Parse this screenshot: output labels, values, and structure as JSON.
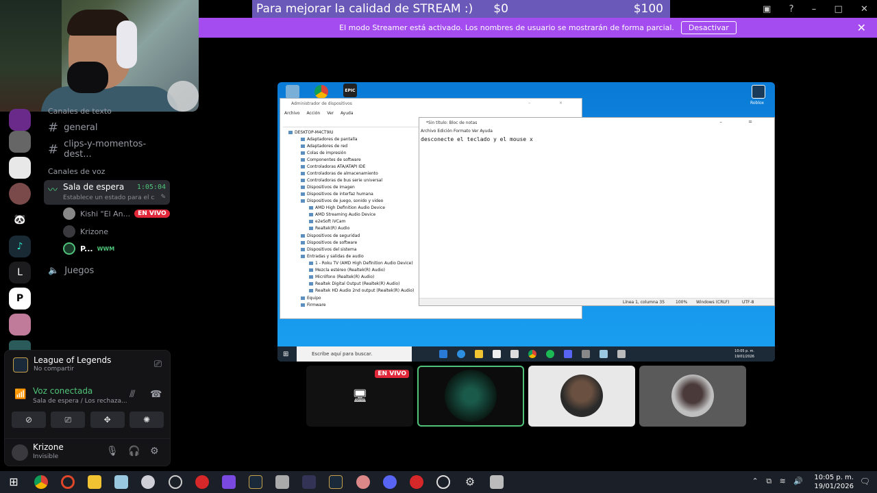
{
  "donation": {
    "title": "Para mejorar la calidad de STREAM :)",
    "current": "$0",
    "goal": "$100"
  },
  "streamer_banner": {
    "message": "El modo Streamer está activado. Los nombres de usuario se mostrarán de forma parcial.",
    "button": "Desactivar"
  },
  "server_rail": {
    "letter_server": "L"
  },
  "channels": {
    "text_category": "Canales de texto",
    "text": [
      "general",
      "clips-y-momentos-dest..."
    ],
    "voice_category": "Canales de voz",
    "active_voice": {
      "name": "Sala de espera",
      "time": "1:05:04",
      "status": "Establece un estado para el ca..."
    },
    "voice_users": [
      {
        "name": "Kishi \"El An...",
        "badge": "EN VIVO"
      },
      {
        "name": "Krizone",
        "badge": ""
      },
      {
        "name": "P...",
        "badge": "WWM"
      }
    ],
    "other_voice": "Juegos"
  },
  "activity": {
    "game": "League of Legends",
    "sub": "No compartir"
  },
  "voice_connection": {
    "title": "Voz conectada",
    "sub": "Sala de espera / Los rechaza..."
  },
  "user": {
    "name": "Krizone",
    "status": "Invisible"
  },
  "stream": {
    "desktop_icons": {
      "epic": "EPIC",
      "roblox": "Roblox"
    },
    "device_manager": {
      "title": "Administrador de dispositivos",
      "menu": [
        "Archivo",
        "Acción",
        "Ver",
        "Ayuda"
      ],
      "tree": [
        "DESKTOP-M4CT9IU",
        "Adaptadores de pantalla",
        "Adaptadores de red",
        "Colas de impresión",
        "Componentes de software",
        "Controladoras ATA/ATAPI IDE",
        "Controladoras de almacenamiento",
        "Controladoras de bus serie universal",
        "Dispositivos de imagen",
        "Dispositivos de interfaz humana",
        "Dispositivos de juego, sonido y video",
        "AMD High Definition Audio Device",
        "AMD Streaming Audio Device",
        "e2eSoft iVCam",
        "Realtek(R) Audio",
        "Dispositivos de seguridad",
        "Dispositivos de software",
        "Dispositivos del sistema",
        "Entradas y salidas de audio",
        "1 - Roku TV (AMD High Definition Audio Device)",
        "Mezcla estéreo (Realtek(R) Audio)",
        "Micrófono (Realtek(R) Audio)",
        "Realtek Digital Output (Realtek(R) Audio)",
        "Realtek HD Audio 2nd output (Realtek(R) Audio)",
        "Equipo",
        "Firmware"
      ]
    },
    "notepad": {
      "title": "*Sin título: Bloc de notas",
      "menu": "Archivo Edición Formato Ver Ayuda",
      "text": "desconecte el teclado y el mouse x",
      "status_pos": "Línea 1, columna 35",
      "status_zoom": "100%",
      "status_eol": "Windows (CRLF)",
      "status_enc": "UTF-8"
    },
    "taskbar": {
      "search": "Escribe aquí para buscar.",
      "time": "10:05 p. m.",
      "date": "19/01/2026"
    }
  },
  "tiles": {
    "live": "EN VIVO"
  },
  "host_taskbar": {
    "time": "10:05 p. m.",
    "date": "19/01/2026"
  }
}
